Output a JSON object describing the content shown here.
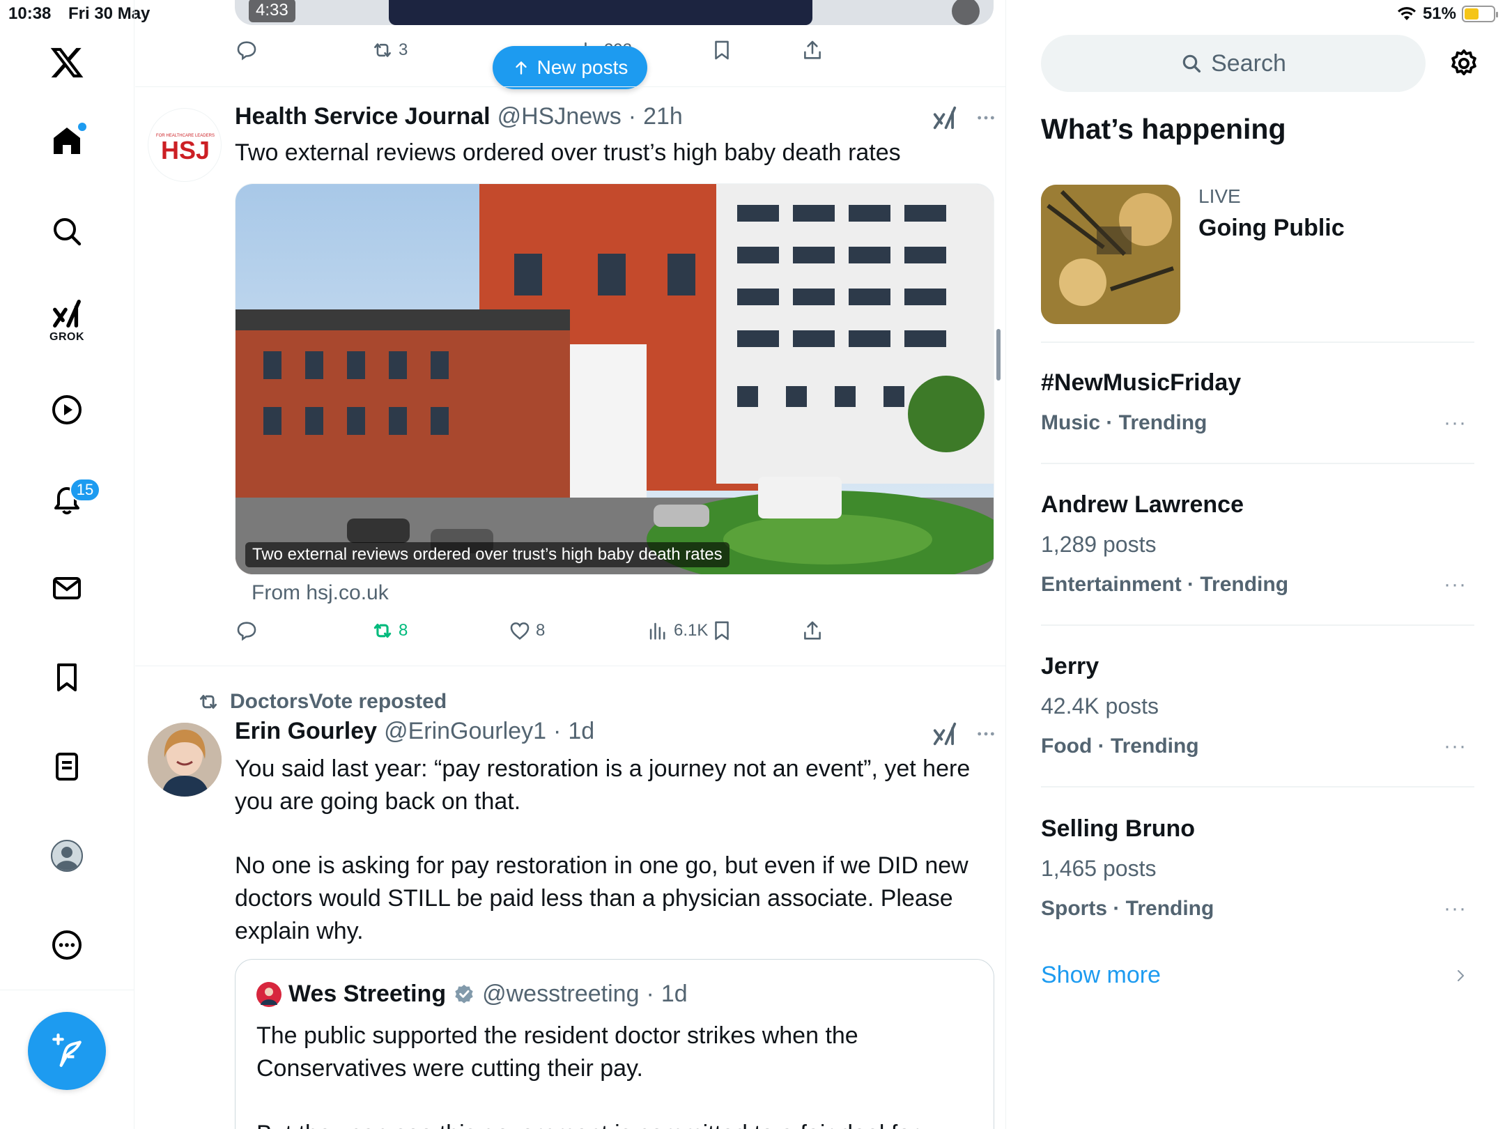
{
  "status_bar": {
    "time": "10:38",
    "date": "Fri 30 May",
    "battery": "51%",
    "battery_level": 0.51
  },
  "nav": {
    "notifications_badge": "15",
    "grok_label": "GROK"
  },
  "video_post": {
    "duration": "4:33",
    "reposts": "3",
    "views": "293"
  },
  "new_posts_label": "New posts",
  "post1": {
    "name": "Health Service Journal",
    "handle": "@HSJnews",
    "dot": "·",
    "time": "21h",
    "text": "Two external reviews ordered over trust’s high baby death rates",
    "avatar_text": "HSJ",
    "avatar_small": "FOR HEALTHCARE LEADERS",
    "media_caption": "Two external reviews ordered over trust’s high baby death rates",
    "from": "From hsj.co.uk",
    "reposts": "8",
    "likes": "8",
    "views": "6.1K"
  },
  "post2": {
    "repost_line": "DoctorsVote reposted",
    "name": "Erin Gourley",
    "handle": "@ErinGourley1",
    "dot": "·",
    "time": "1d",
    "text1": "You said last year: “pay restoration is a journey not an event”, yet here you are going back on that.",
    "text2": "No one is asking for pay restoration in one go, but even if we DID new doctors would STILL be paid less than a physician associate. Please explain why.",
    "quote": {
      "name": "Wes Streeting",
      "handle": "@wesstreeting",
      "dot": "·",
      "time": "1d",
      "text": "The public supported the resident doctor strikes when the Conservatives were cutting their pay.",
      "text_cut": "But they can see this government is committed to a fair deal for"
    }
  },
  "sidebar": {
    "search_placeholder": "Search",
    "title": "What’s happening",
    "live": {
      "label": "LIVE",
      "title": "Going Public"
    },
    "trends": [
      {
        "name": "#NewMusicFriday",
        "count": "",
        "meta": "Music · Trending"
      },
      {
        "name": "Andrew Lawrence",
        "count": "1,289 posts",
        "meta": "Entertainment · Trending"
      },
      {
        "name": "Jerry",
        "count": "42.4K posts",
        "meta": "Food · Trending"
      },
      {
        "name": "Selling Bruno",
        "count": "1,465 posts",
        "meta": "Sports · Trending"
      }
    ],
    "more_glyph": "···",
    "show_more": "Show more"
  },
  "colors": {
    "accent": "#1d9bf0",
    "repost_green": "#00ba7c",
    "text_secondary": "#536471"
  }
}
